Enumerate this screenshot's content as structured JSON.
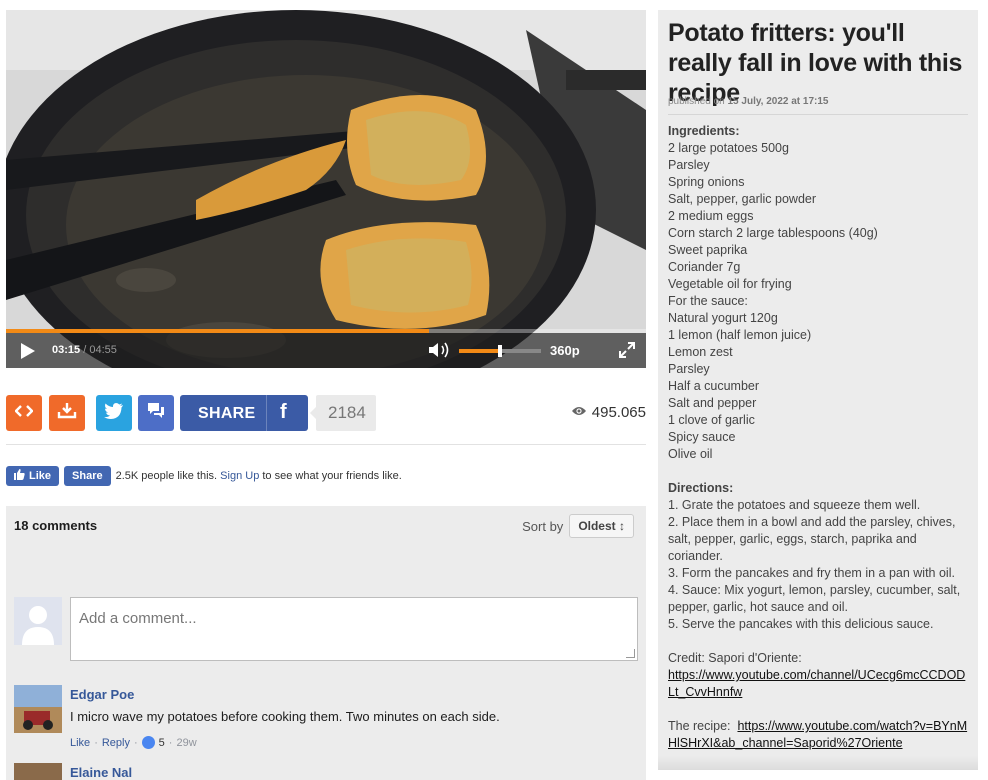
{
  "player": {
    "current_time": "03:15",
    "duration": "04:55",
    "progress": 0.661,
    "volume": 0.5,
    "quality": "360p"
  },
  "share": {
    "share_label": "SHARE",
    "facebook_glyph": "f",
    "share_count": "2184",
    "views": "495.065",
    "icons": [
      "embed-icon",
      "download-icon",
      "twitter-icon",
      "messenger-icon",
      "facebook-icon",
      "eye-icon"
    ]
  },
  "facebook": {
    "like_label": "Like",
    "share_label": "Share",
    "social_text": "2.5K people like this.",
    "signup_link": "Sign Up",
    "signup_suffix": "to see what your friends like."
  },
  "comments": {
    "count_label": "18 comments",
    "sort_label": "Sort by",
    "sort_value": "Oldest",
    "input_placeholder": "Add a comment...",
    "items": [
      {
        "author": "Edgar Poe",
        "text": "I micro wave my potatoes before cooking them. Two minutes on each side.",
        "like_action": "Like",
        "reply_action": "Reply",
        "likes": "5",
        "age": "29w"
      },
      {
        "author": "Elaine Nal"
      }
    ]
  },
  "article": {
    "title": "Potato fritters: you'll really fall in love with this recipe",
    "published_prefix": "published on",
    "published_date": "15 July, 2022 at 17:15",
    "ingredients_heading": "Ingredients:",
    "ingredients": [
      "2 large potatoes 500g",
      "Parsley",
      "Spring onions",
      "Salt, pepper, garlic powder",
      "2 medium eggs",
      "Corn starch 2 large tablespoons (40g)",
      "Sweet paprika",
      "Coriander 7g",
      "Vegetable oil for frying",
      "For the sauce:",
      "Natural yogurt 120g",
      "1 lemon (half lemon juice)",
      "Lemon zest",
      "Parsley",
      "Half a cucumber",
      "Salt and pepper",
      "1 clove of garlic",
      "Spicy sauce",
      "Olive oil"
    ],
    "directions_heading": "Directions:",
    "directions": [
      "1. Grate the potatoes and squeeze them well.",
      "2. Place them in a bowl and add the parsley, chives, salt, pepper, garlic, eggs, starch, paprika and coriander.",
      "3. Form the pancakes and fry them in a pan with oil.",
      "4. Sauce: Mix yogurt, lemon, parsley, cucumber, salt, pepper, garlic, hot sauce and oil.",
      "5. Serve the pancakes with this delicious sauce."
    ],
    "credit_label": "Credit: Sapori d'Oriente:",
    "credit_url": "https://www.youtube.com/channel/UCecg6mcCCDODLt_CvvHnnfw",
    "recipe_label": "The recipe:",
    "recipe_url": "https://www.youtube.com/watch?v=BYnMHlSHrXI&ab_channel=Saporid%27Oriente"
  },
  "colors": {
    "accent_orange": "#f06a2a",
    "twitter_blue": "#2aa3e0",
    "facebook_blue": "#3b5ba6",
    "link_blue": "#365899",
    "sidebar_bg": "#ececec"
  }
}
